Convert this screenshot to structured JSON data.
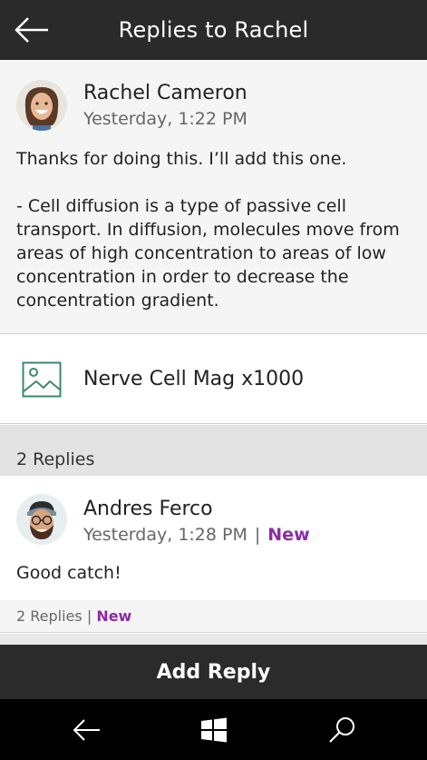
{
  "header": {
    "title": "Replies to Rachel",
    "back_icon": "arrow-left-icon"
  },
  "post": {
    "author": "Rachel Cameron",
    "timestamp": "Yesterday, 1:22 PM",
    "body": "Thanks for doing this. I’ll add this one.\n\n- Cell diffusion is a type of passive cell transport. In diffusion, molecules move from areas of high concentration to areas of low concentration in order to decrease the concentration gradient."
  },
  "attachment": {
    "label": "Nerve Cell Mag x1000",
    "icon": "image-icon"
  },
  "replies_header": {
    "label": "2 Replies"
  },
  "reply": {
    "author": "Andres Ferco",
    "timestamp": "Yesterday, 1:28 PM",
    "separator": "|",
    "new_label": "New",
    "body": "Good catch!",
    "footer_count": "2 Replies",
    "footer_separator": "|",
    "footer_new": "New"
  },
  "actions": {
    "add_reply": "Add Reply"
  },
  "system_bar": {
    "back_icon": "back-arrow-icon",
    "start_icon": "windows-logo-icon",
    "search_icon": "search-icon"
  },
  "colors": {
    "header_bg": "#2a2a2a",
    "new_accent": "#8e2aa8",
    "sysbar_bg": "#000000"
  }
}
